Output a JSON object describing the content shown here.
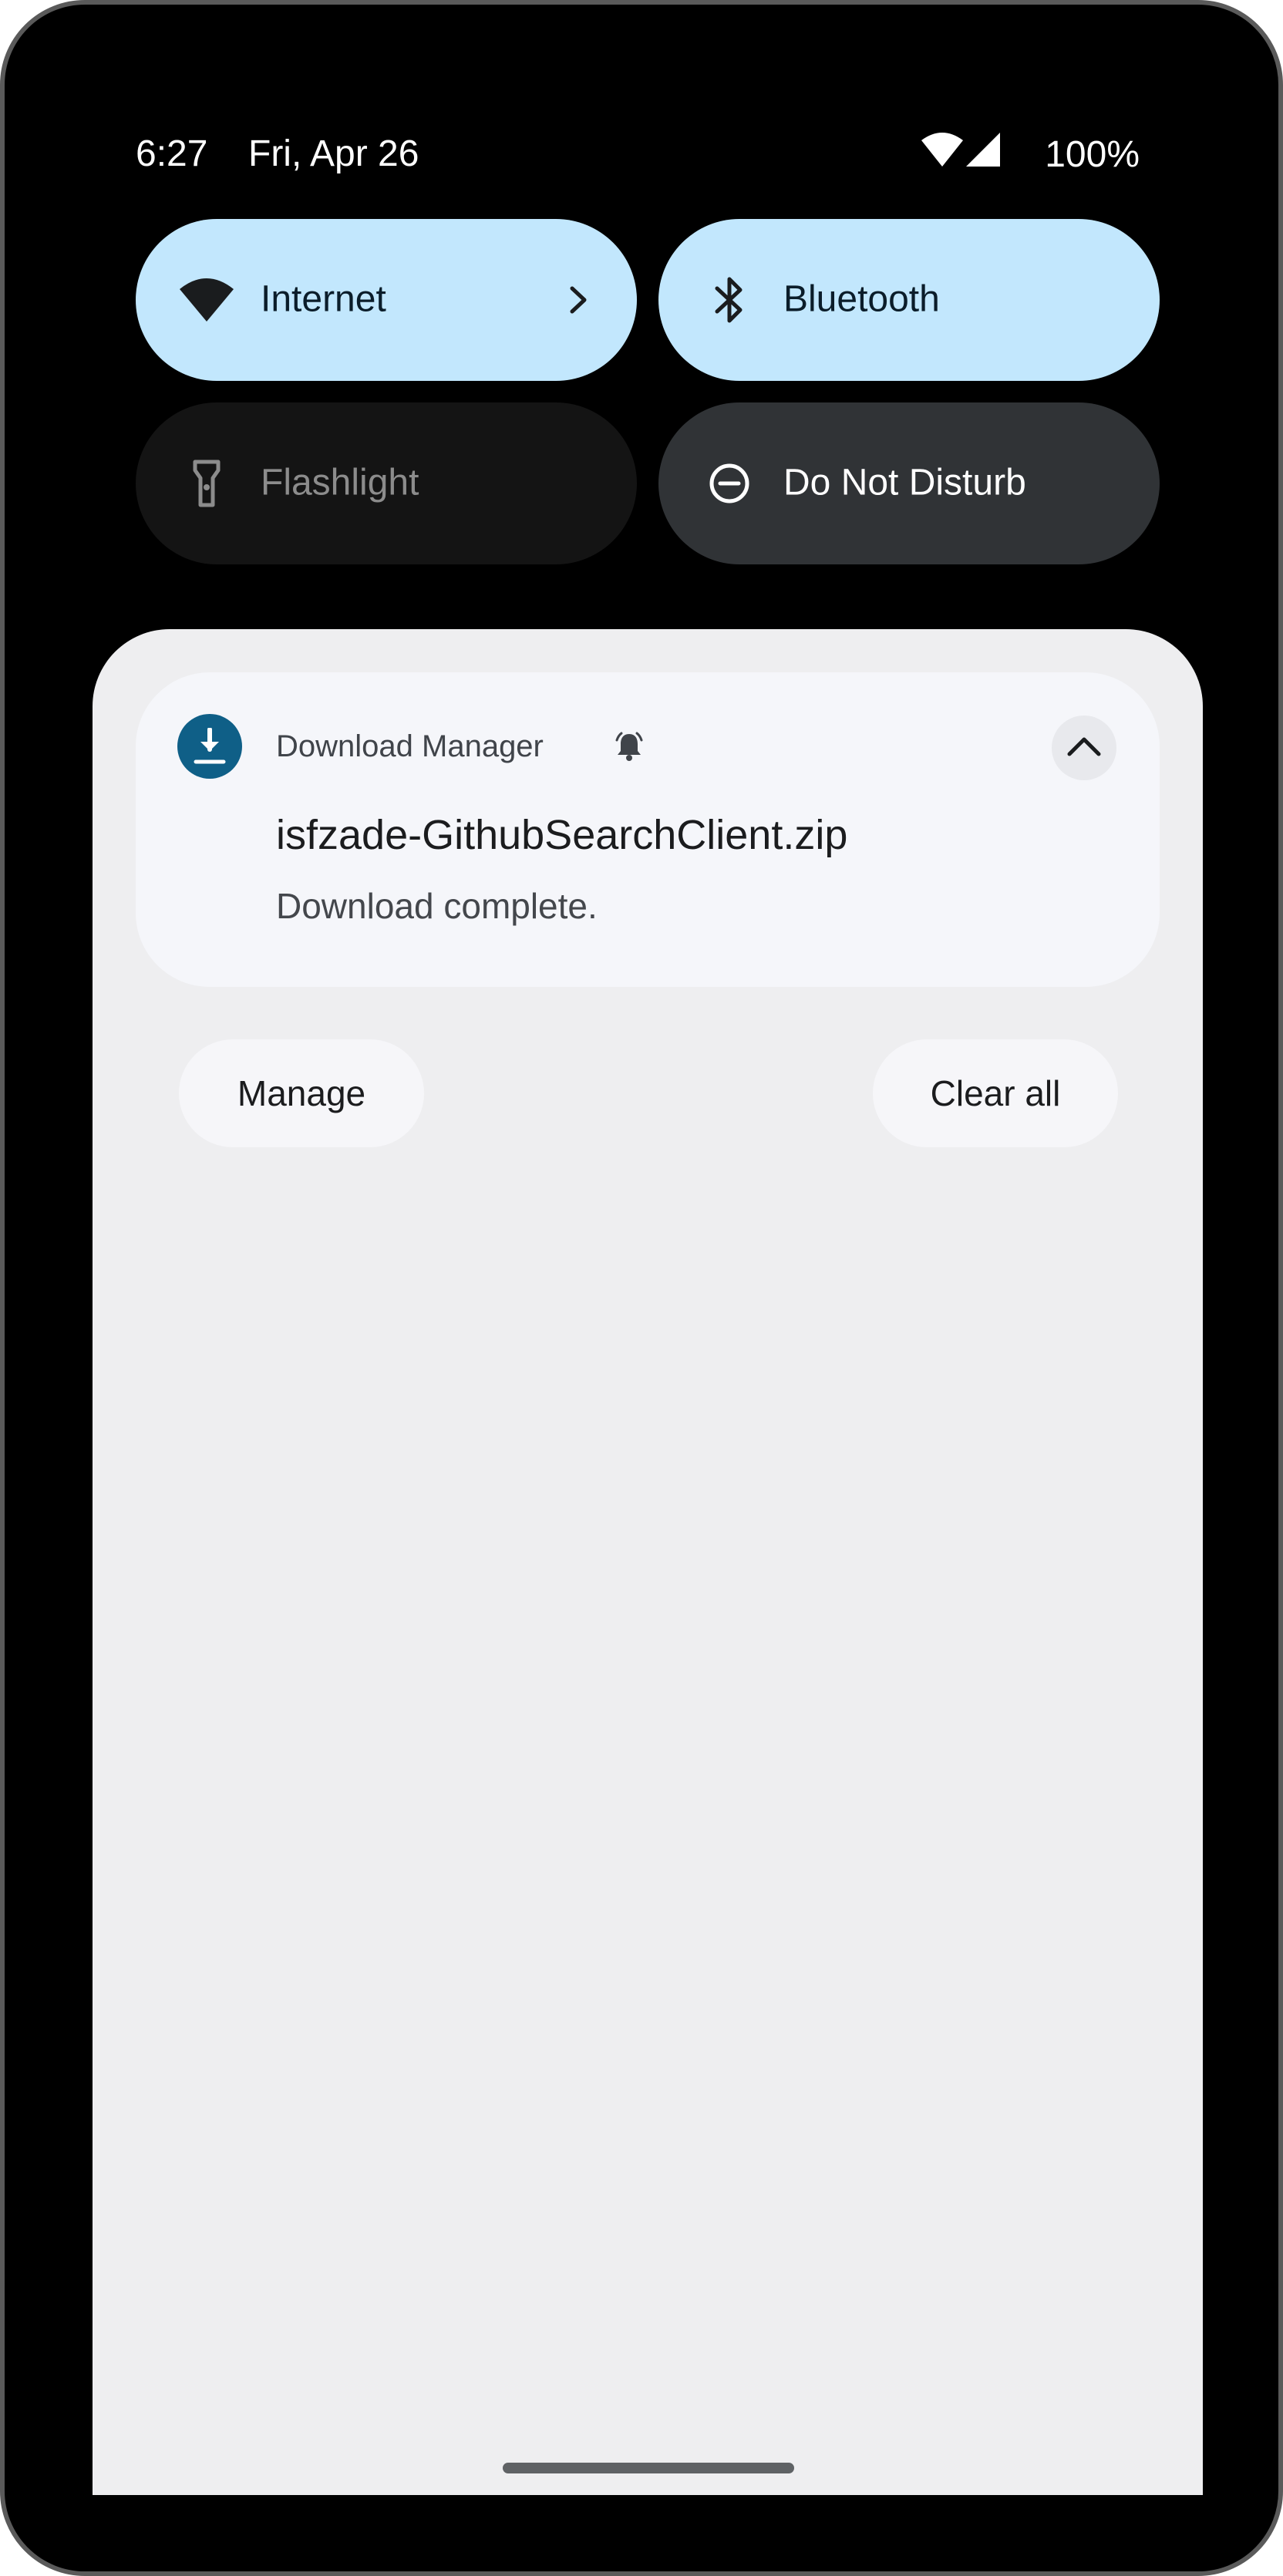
{
  "status_bar": {
    "time": "6:27",
    "date": "Fri, Apr 26",
    "battery": "100%",
    "icons": [
      "wifi-icon",
      "cellular-signal-icon"
    ]
  },
  "quick_settings": {
    "internet": {
      "label": "Internet",
      "icon": "wifi-icon",
      "state": "on"
    },
    "bluetooth": {
      "label": "Bluetooth",
      "icon": "bluetooth-icon",
      "state": "on"
    },
    "flashlight": {
      "label": "Flashlight",
      "icon": "flashlight-icon",
      "state": "unavailable"
    },
    "dnd": {
      "label": "Do Not Disturb",
      "icon": "do-not-disturb-icon",
      "state": "off"
    }
  },
  "notification": {
    "app_name": "Download Manager",
    "app_icon": "download-icon",
    "title": "isfzade-GithubSearchClient.zip",
    "text": "Download complete."
  },
  "actions": {
    "manage_label": "Manage",
    "clear_all_label": "Clear all"
  },
  "colors": {
    "active_tile": "#c2e7fd",
    "dnd_tile": "#303336",
    "shade_bg": "#eeeef0",
    "app_icon_bg": "#0f5f87"
  }
}
